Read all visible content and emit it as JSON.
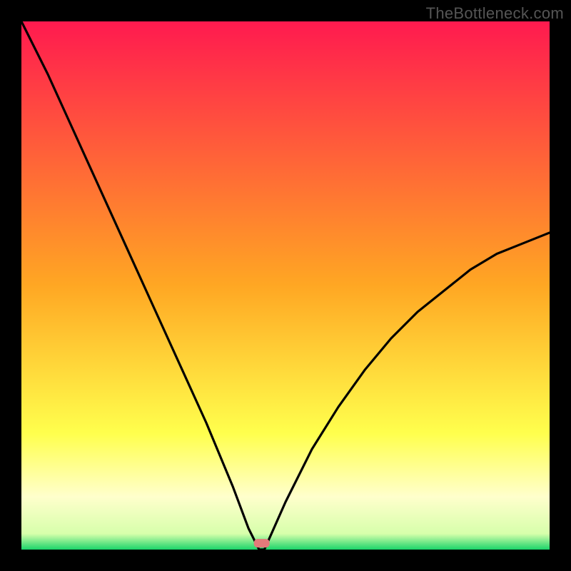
{
  "watermark": "TheBottleneck.com",
  "chart_data": {
    "type": "line",
    "title": "",
    "xlabel": "",
    "ylabel": "",
    "xlim": [
      0,
      100
    ],
    "ylim": [
      0,
      100
    ],
    "grid": false,
    "background_gradient": {
      "stops": [
        {
          "offset": 0.0,
          "color": "#ff1a4f"
        },
        {
          "offset": 0.5,
          "color": "#ffa723"
        },
        {
          "offset": 0.78,
          "color": "#ffff4d"
        },
        {
          "offset": 0.9,
          "color": "#ffffcc"
        },
        {
          "offset": 0.97,
          "color": "#d7ffab"
        },
        {
          "offset": 1.0,
          "color": "#1bd46a"
        }
      ]
    },
    "series": [
      {
        "name": "bottleneck-curve",
        "x": [
          0,
          5,
          10,
          15,
          20,
          25,
          30,
          35,
          40,
          43,
          45,
          46,
          50,
          55,
          60,
          65,
          70,
          75,
          80,
          85,
          90,
          95,
          100
        ],
        "y": [
          100,
          90,
          79,
          68,
          57,
          46,
          35,
          24,
          12,
          4,
          0,
          0,
          9,
          19,
          27,
          34,
          40,
          45,
          49,
          53,
          56,
          58,
          60
        ]
      }
    ],
    "marker": {
      "x": 45.5,
      "y": 1.2,
      "color": "#e27a7a",
      "label": ""
    }
  },
  "frame": {
    "border_color": "#000000",
    "border_px": 30
  }
}
